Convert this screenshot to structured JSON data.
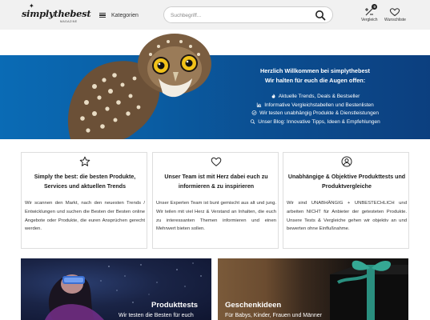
{
  "header": {
    "logo_text": "simplythebest",
    "logo_sub": "MAGAZINE",
    "categories_label": "Kategorien",
    "search_placeholder": "Suchbegriff...",
    "compare_label": "Vergleich",
    "compare_count": "0",
    "wishlist_label": "Wunschliste"
  },
  "hero": {
    "title_line1": "Herzlich Willkommen bei simplythebest",
    "title_line2": "Wir halten für euch die Augen offen:",
    "items": [
      {
        "icon": "fire-icon",
        "text": "Aktuelle Trends, Deals & Bestseller"
      },
      {
        "icon": "chart-icon",
        "text": "Informative Vergleichstabellen und Bestenlisten"
      },
      {
        "icon": "check-circle-icon",
        "text": "Wir testen unabhängig Produkte & Dienstleistungen"
      },
      {
        "icon": "search-icon",
        "text": "Unser Blog: Innovative Tipps, Ideen & Empfehlungen"
      }
    ]
  },
  "cards": [
    {
      "icon": "star-icon",
      "title": "Simply the best: die besten Produkte, Services und aktuellen Trends",
      "text": "Wir scannen den Markt, nach den neuesten Trends / Entwicklungen und suchen die Besten der Besten online Angebote oder Produkte, die euren Ansprüchen gerecht werden."
    },
    {
      "icon": "heart-icon",
      "title": "Unser Team ist mit Herz dabei euch zu informieren & zu inspirieren",
      "text": "Unser Experten Team ist bunt gemischt aus alt und jung. Wir teilen mit viel Herz & Verstand an Inhalten, die euch zu interessanten Themen informieren und einen Mehrwert bieten sollen."
    },
    {
      "icon": "user-icon",
      "title": "Unabhängige & Objektive Produkttests und Produktvergleiche",
      "text": "Wir sind UNABHÄNGIG + UNBESTECHLICH und arbeiten NICHT für Anbieter der getesteten Produkte. Unsere Tests & Vergleiche gehen wir objektiv an und bewerten ohne Einflußnahme."
    }
  ],
  "tiles": [
    {
      "title": "Produkttests",
      "subtitle": "Wir testen die Besten für euch"
    },
    {
      "title": "Geschenkideen",
      "subtitle": "Für Babys, Kinder, Frauen und Männer"
    }
  ],
  "colors": {
    "hero_blue": "#0a5da3",
    "header_bg": "#f1f1f1"
  }
}
